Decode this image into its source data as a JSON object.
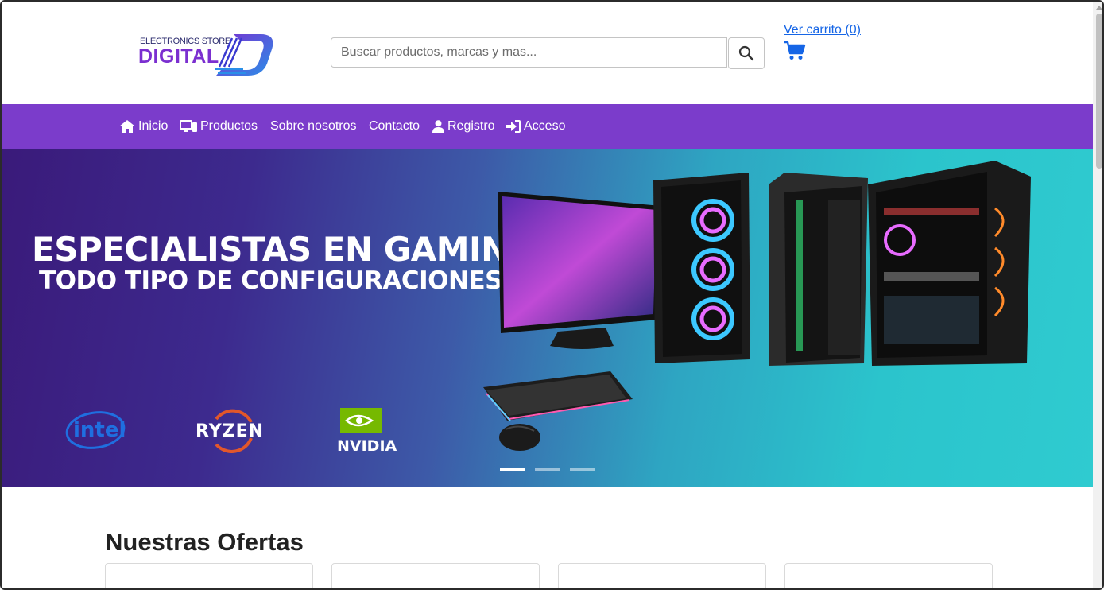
{
  "logo": {
    "small_text": "ELECTRONICS STORE",
    "big_text": "DIGITAL"
  },
  "search": {
    "placeholder": "Buscar productos, marcas y mas..."
  },
  "cart": {
    "label": "Ver carrito (0)"
  },
  "nav": {
    "items": [
      {
        "label": "Inicio",
        "icon": "home-icon"
      },
      {
        "label": "Productos",
        "icon": "devices-icon"
      },
      {
        "label": "Sobre nosotros",
        "icon": ""
      },
      {
        "label": "Contacto",
        "icon": ""
      },
      {
        "label": "Registro",
        "icon": "user-icon"
      },
      {
        "label": "Acceso",
        "icon": "sign-in-icon"
      }
    ]
  },
  "hero": {
    "title": "ESPECIALISTAS EN GAMING",
    "subtitle": "TODO TIPO DE CONFIGURACIONES",
    "brands": [
      "intel",
      "RYZEN",
      "NVIDIA"
    ],
    "slides": 3,
    "active_slide": 1
  },
  "offers": {
    "title": "Nuestras Ofertas"
  },
  "colors": {
    "nav_bg": "#7b3ccb",
    "link": "#1565e6",
    "logo_purple": "#7b2fd0"
  }
}
